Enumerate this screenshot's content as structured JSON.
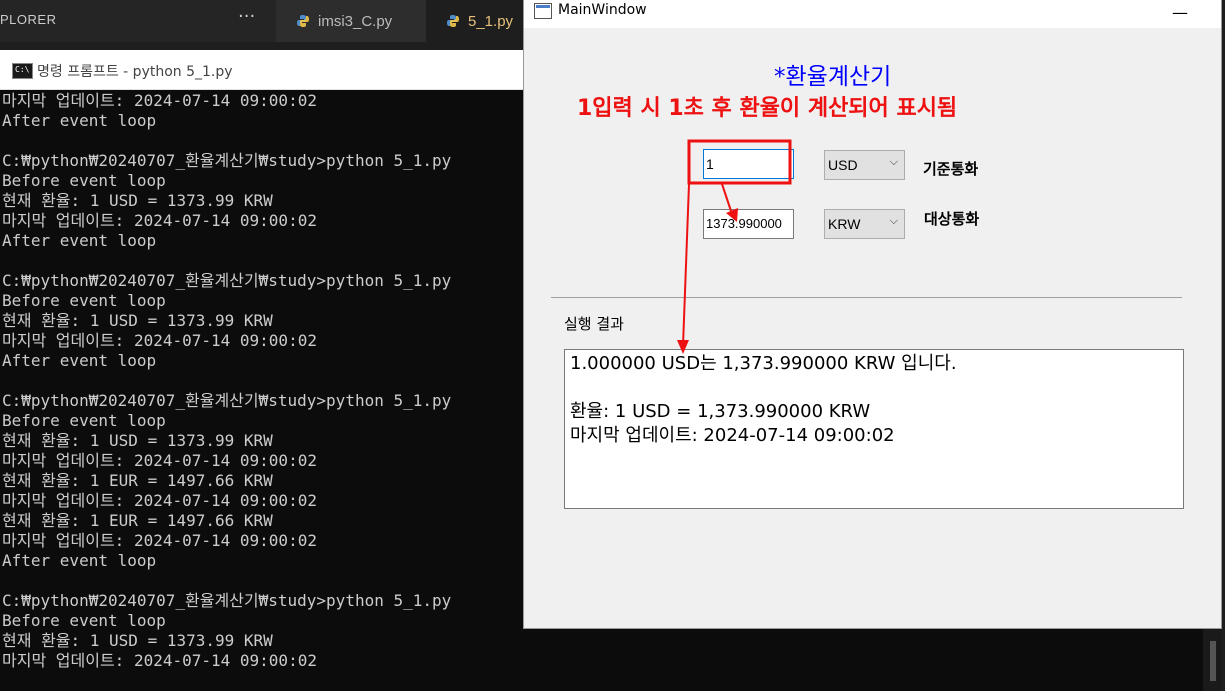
{
  "vscode": {
    "explorer_label": "PLORER",
    "more_label": "···",
    "tabs": [
      {
        "label": "imsi3_C.py"
      },
      {
        "label": "5_1.py"
      }
    ]
  },
  "cmd": {
    "title": "명령 프롬프트 - python  5_1.py",
    "lines": [
      "마지막 업데이트: 2024-07-14 09:00:02",
      "After event loop",
      "",
      "C:₩python₩20240707_환율계산기₩study>python 5_1.py",
      "Before event loop",
      "현재 환율: 1 USD = 1373.99 KRW",
      "마지막 업데이트: 2024-07-14 09:00:02",
      "After event loop",
      "",
      "C:₩python₩20240707_환율계산기₩study>python 5_1.py",
      "Before event loop",
      "현재 환율: 1 USD = 1373.99 KRW",
      "마지막 업데이트: 2024-07-14 09:00:02",
      "After event loop",
      "",
      "C:₩python₩20240707_환율계산기₩study>python 5_1.py",
      "Before event loop",
      "현재 환율: 1 USD = 1373.99 KRW",
      "마지막 업데이트: 2024-07-14 09:00:02",
      "현재 환율: 1 EUR = 1497.66 KRW",
      "마지막 업데이트: 2024-07-14 09:00:02",
      "현재 환율: 1 EUR = 1497.66 KRW",
      "마지막 업데이트: 2024-07-14 09:00:02",
      "After event loop",
      "",
      "C:₩python₩20240707_환율계산기₩study>python 5_1.py",
      "Before event loop",
      "현재 환율: 1 USD = 1373.99 KRW",
      "마지막 업데이트: 2024-07-14 09:00:02"
    ]
  },
  "app": {
    "window_title": "MainWindow",
    "minimize_label": "—",
    "heading": "*환율계산기",
    "annotation": "1입력 시 1초 후 환율이 계산되어 표시됨",
    "amount_value": "1",
    "result_value": "1373.990000",
    "base_currency": "USD",
    "target_currency": "KRW",
    "base_label": "기준통화",
    "target_label": "대상통화",
    "result_section_label": "실행 결과",
    "result_lines": [
      "1.000000 USD는 1,373.990000 KRW 입니다.",
      "",
      "환율: 1 USD = 1,373.990000 KRW",
      "마지막 업데이트: 2024-07-14 09:00:02"
    ],
    "annotation_color": "#ee1111",
    "heading_color": "#0000ff"
  }
}
